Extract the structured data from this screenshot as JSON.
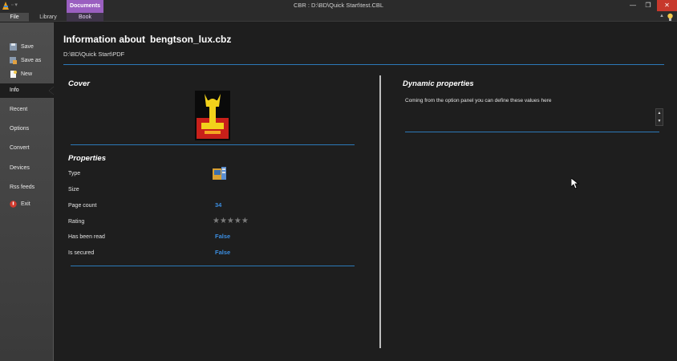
{
  "window": {
    "title": "CBR : D:\\BD\\Quick Start\\test.CBL",
    "min_glyph": "—",
    "max_glyph": "❐",
    "close_glyph": "✕"
  },
  "ribbon": {
    "contextual_header": "Documents",
    "tabs": {
      "file": "File",
      "library": "Library",
      "book": "Book"
    },
    "collapse_glyph": "▲"
  },
  "sidebar": {
    "actions": [
      {
        "label": "Save",
        "icon": "save-icon"
      },
      {
        "label": "Save as",
        "icon": "save-as-icon"
      },
      {
        "label": "New",
        "icon": "new-icon"
      }
    ],
    "items": [
      {
        "label": "Info",
        "active": true
      },
      {
        "label": "Recent"
      },
      {
        "label": "Options"
      },
      {
        "label": "Convert"
      },
      {
        "label": "Devices"
      },
      {
        "label": "Rss feeds"
      },
      {
        "label": "Exit",
        "icon": "exit-icon"
      }
    ]
  },
  "info": {
    "title_prefix": "Information about",
    "filename": "bengtson_lux.cbz",
    "path": "D:\\BD\\Quick Start\\PDF",
    "cover_title": "Cover",
    "properties_title": "Properties",
    "properties": {
      "type_label": "Type",
      "size_label": "Size",
      "page_count_label": "Page count",
      "page_count": "34",
      "rating_label": "Rating",
      "rating_stars": "★★★★★",
      "rating_value": 0,
      "read_label": "Has been read",
      "read_value": "False",
      "secured_label": "Is secured",
      "secured_value": "False"
    },
    "dynamic_title": "Dynamic properties",
    "dynamic_desc": "Coming from the option panel you can define these values here"
  },
  "colors": {
    "accent_blue": "#2c79b8",
    "value_blue": "#3b8de0",
    "contextual_purple": "#9a5fc0",
    "close_red": "#c7382c"
  }
}
